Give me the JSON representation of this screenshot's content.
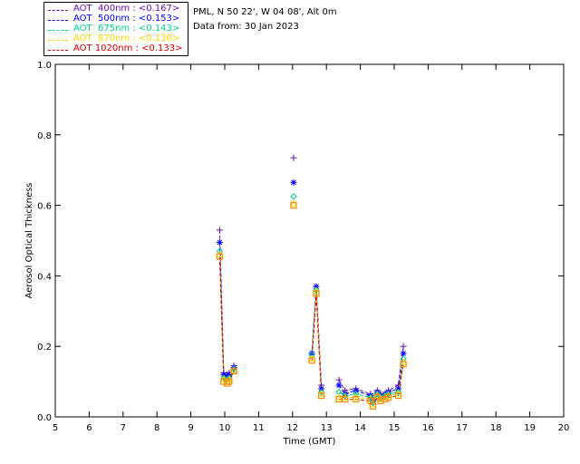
{
  "header": {
    "station": "PML, N 50 22', W 04 08', Alt 0m",
    "date": "Data from: 30 Jan 2023"
  },
  "legend": [
    {
      "label": "AOT  400nm : <0.167>",
      "color": "#6a0dad"
    },
    {
      "label": "AOT  500nm : <0.153>",
      "color": "#0000ff"
    },
    {
      "label": "AOT  675nm : <0.143>",
      "color": "#00cc88"
    },
    {
      "label": "AOT  870nm : <0.136>",
      "color": "#ffd700"
    },
    {
      "label": "AOT 1020nm : <0.133>",
      "color": "#cc0000"
    }
  ],
  "chart_data": {
    "type": "line",
    "xlabel": "Time (GMT)",
    "ylabel": "Aerosol Optical Thickness",
    "xlim": [
      5,
      20
    ],
    "ylim": [
      0.0,
      1.0
    ],
    "xticks": [
      5,
      6,
      7,
      8,
      9,
      10,
      11,
      12,
      13,
      14,
      15,
      16,
      17,
      18,
      19,
      20
    ],
    "yticks": [
      "0.0",
      "0.2",
      "0.4",
      "0.6",
      "0.8",
      "1.0"
    ],
    "ytick_values": [
      0.0,
      0.2,
      0.4,
      0.6,
      0.8,
      1.0
    ],
    "x": [
      9.85,
      9.97,
      10.07,
      10.13,
      10.27,
      12.03,
      12.57,
      12.7,
      12.85,
      13.37,
      13.55,
      13.87,
      14.3,
      14.37,
      14.5,
      14.6,
      14.73,
      14.83,
      15.12,
      15.27
    ],
    "segments": [
      [
        0,
        4
      ],
      [
        5,
        5
      ],
      [
        6,
        8
      ],
      [
        9,
        19
      ]
    ],
    "series": [
      {
        "name": "AOT  400nm : <0.167>",
        "color": "#6a0dad",
        "marker": "plus",
        "values": [
          0.53,
          0.125,
          0.12,
          0.125,
          0.145,
          0.735,
          0.18,
          0.37,
          0.09,
          0.105,
          0.075,
          0.08,
          0.065,
          0.05,
          0.075,
          0.065,
          0.065,
          0.075,
          0.09,
          0.2
        ]
      },
      {
        "name": "AOT  500nm : <0.153>",
        "color": "#0000ff",
        "marker": "star",
        "values": [
          0.495,
          0.12,
          0.115,
          0.12,
          0.14,
          0.665,
          0.18,
          0.37,
          0.08,
          0.09,
          0.065,
          0.075,
          0.06,
          0.045,
          0.07,
          0.06,
          0.065,
          0.07,
          0.08,
          0.18
        ]
      },
      {
        "name": "AOT  675nm : <0.143>",
        "color": "#00cc88",
        "marker": "diamond",
        "values": [
          0.47,
          0.11,
          0.105,
          0.11,
          0.135,
          0.625,
          0.175,
          0.36,
          0.07,
          0.07,
          0.06,
          0.065,
          0.055,
          0.04,
          0.065,
          0.055,
          0.06,
          0.065,
          0.07,
          0.165
        ]
      },
      {
        "name": "AOT  870nm : <0.136>",
        "color": "#ffd700",
        "marker": "triangle",
        "values": [
          0.46,
          0.105,
          0.1,
          0.105,
          0.13,
          0.605,
          0.165,
          0.355,
          0.065,
          0.055,
          0.055,
          0.055,
          0.05,
          0.035,
          0.06,
          0.05,
          0.055,
          0.06,
          0.065,
          0.155
        ]
      },
      {
        "name": "AOT 1020nm : <0.133>",
        "color": "#cc0000",
        "marker": "square",
        "values": [
          0.455,
          0.1,
          0.095,
          0.1,
          0.13,
          0.6,
          0.16,
          0.35,
          0.06,
          0.05,
          0.05,
          0.05,
          0.045,
          0.03,
          0.055,
          0.045,
          0.05,
          0.055,
          0.06,
          0.15
        ]
      }
    ],
    "overlay_marker_color": "#ff8c00",
    "grid": false,
    "legend_position": "top-left"
  }
}
